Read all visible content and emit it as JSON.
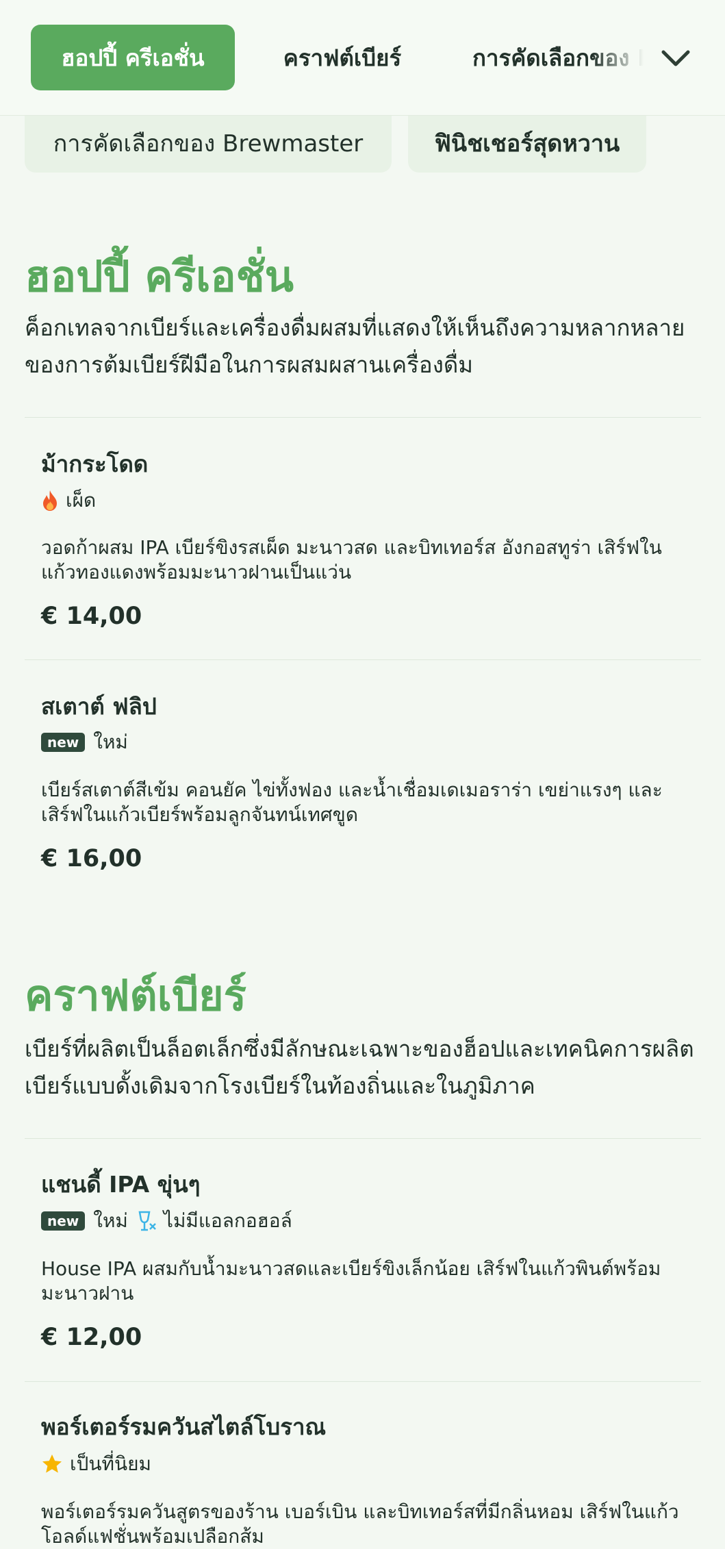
{
  "nav": {
    "tabs": [
      {
        "label": "ฮอปปี้ ครีเอชั่น"
      },
      {
        "label": "คราฟต์เบียร์"
      },
      {
        "label": "การคัดเลือกของ Brewmaster"
      }
    ],
    "more_icon": "chevron-down-icon"
  },
  "chips": [
    {
      "label": "การคัดเลือกของ Brewmaster"
    },
    {
      "label": "ฟินิชเชอร์สุดหวาน"
    }
  ],
  "sections": [
    {
      "title": "ฮอปปี้ ครีเอชั่น",
      "description": "ค็อกเทลจากเบียร์และเครื่องดื่มผสมที่แสดงให้เห็นถึงความหลากหลายของการต้มเบียร์ฝีมือในการผสมผสานเครื่องดื่ม",
      "items": [
        {
          "name": "ม้ากระโดด",
          "tags": [
            {
              "icon": "fire-icon",
              "label": "เผ็ด"
            }
          ],
          "description": "วอดก้าผสม IPA เบียร์ขิงรสเผ็ด มะนาวสด และบิทเทอร์ส อังกอสทูร่า เสิร์ฟในแก้วทองแดงพร้อมมะนาวฝานเป็นแว่น",
          "price": "€ 14,00"
        },
        {
          "name": "สเตาต์ ฟลิป",
          "tags": [
            {
              "icon": "new-badge",
              "badge": "new",
              "label": "ใหม่"
            }
          ],
          "description": "เบียร์สเตาต์สีเข้ม คอนยัค ไข่ทั้งฟอง และน้ำเชื่อมเดเมอราร่า เขย่าแรงๆ และเสิร์ฟในแก้วเบียร์พร้อมลูกจันทน์เทศขูด",
          "price": "€ 16,00"
        }
      ]
    },
    {
      "title": "คราฟต์เบียร์",
      "description": "เบียร์ที่ผลิตเป็นล็อตเล็กซึ่งมีลักษณะเฉพาะของฮ็อปและเทคนิคการผลิตเบียร์แบบดั้งเดิมจากโรงเบียร์ในท้องถิ่นและในภูมิภาค",
      "items": [
        {
          "name": "แชนดี้ IPA ขุ่นๆ",
          "tags": [
            {
              "icon": "new-badge",
              "badge": "new",
              "label": "ใหม่"
            },
            {
              "icon": "no-alcohol-icon",
              "label": "ไม่มีแอลกอฮอล์"
            }
          ],
          "description": "House IPA ผสมกับน้ำมะนาวสดและเบียร์ขิงเล็กน้อย เสิร์ฟในแก้วพินต์พร้อมมะนาวฝาน",
          "price": "€ 12,00"
        },
        {
          "name": "พอร์เตอร์รมควันสไตล์โบราณ",
          "tags": [
            {
              "icon": "star-icon",
              "label": "เป็นที่นิยม"
            }
          ],
          "description": "พอร์เตอร์รมควันสูตรของร้าน เบอร์เบิน และบิทเทอร์สที่มีกลิ่นหอม เสิร์ฟในแก้วโอลด์แฟชั่นพร้อมเปลือกส้ม",
          "price": ""
        }
      ]
    }
  ],
  "colors": {
    "accent": "#5aaa5e",
    "background": "#f3f8f2",
    "text": "#22312a",
    "fire": "#f05a28",
    "star": "#f7b500",
    "no_alcohol": "#3cb4e6"
  }
}
